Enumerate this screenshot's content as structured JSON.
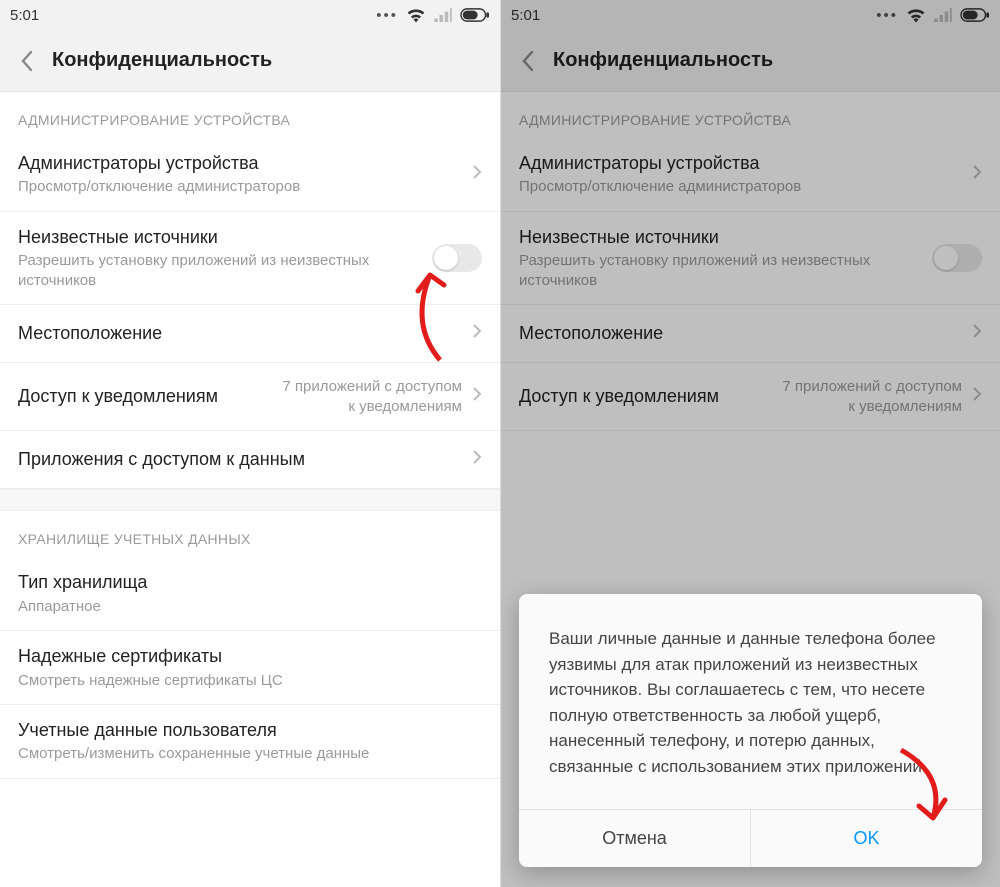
{
  "statusbar": {
    "time": "5:01"
  },
  "header": {
    "title": "Конфиденциальность"
  },
  "sections": {
    "admin": {
      "header": "АДМИНИСТРИРОВАНИЕ УСТРОЙСТВА",
      "device_admins": {
        "title": "Администраторы устройства",
        "sub": "Просмотр/отключение администраторов"
      },
      "unknown_sources": {
        "title": "Неизвестные источники",
        "sub": "Разрешить установку приложений из неизвестных источников"
      },
      "location": {
        "title": "Местоположение"
      },
      "notif_access": {
        "title": "Доступ к уведомлениям",
        "right": "7 приложений с доступом к уведомлениям"
      },
      "data_access": {
        "title": "Приложения с доступом к данным"
      }
    },
    "creds": {
      "header": "ХРАНИЛИЩЕ УЧЕТНЫХ ДАННЫХ",
      "storage_type": {
        "title": "Тип хранилища",
        "sub": "Аппаратное"
      },
      "trusted_certs": {
        "title": "Надежные сертификаты",
        "sub": "Смотреть надежные сертификаты ЦС"
      },
      "user_creds": {
        "title": "Учетные данные пользователя",
        "sub": "Смотреть/изменить сохраненные учетные данные"
      }
    }
  },
  "dialog": {
    "message": "Ваши личные данные и данные телефона более уязвимы для атак приложений из неизвестных источников. Вы соглашаетесь с тем, что несете полную ответственность за любой ущерб, нанесенный телефону, и потерю данных, связанные с использованием этих приложений.",
    "cancel": "Отмена",
    "ok": "OK"
  },
  "colors": {
    "accent": "#0099ff",
    "arrow": "#e21b1b"
  }
}
